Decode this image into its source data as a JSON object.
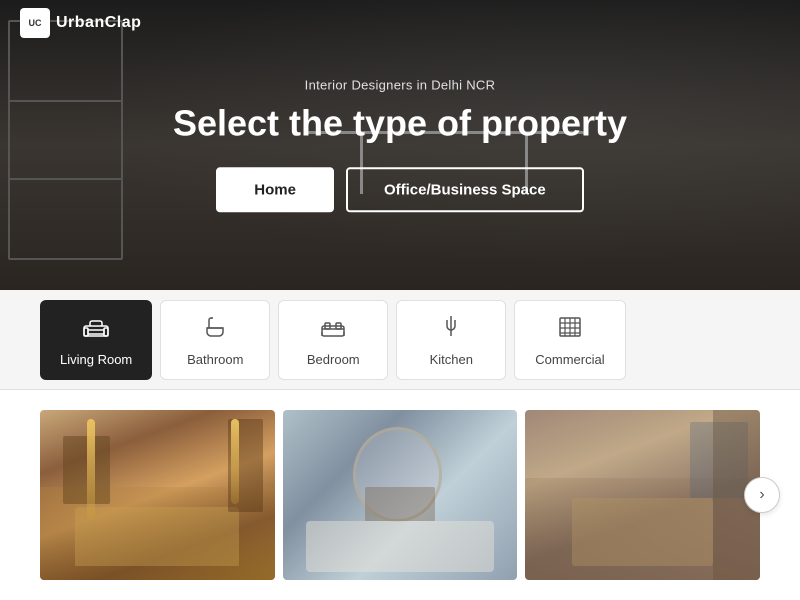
{
  "brand": {
    "logo_abbr": "UC",
    "name": "UrbanClap"
  },
  "hero": {
    "subtitle": "Interior Designers in Delhi NCR",
    "title": "Select the type of property",
    "buttons": [
      {
        "id": "home",
        "label": "Home",
        "style": "white"
      },
      {
        "id": "office",
        "label": "Office/Business Space",
        "style": "outline"
      }
    ]
  },
  "room_types": [
    {
      "id": "living-room",
      "label": "Living Room",
      "icon": "🛋",
      "active": true
    },
    {
      "id": "bathroom",
      "label": "Bathroom",
      "icon": "🛁",
      "active": false
    },
    {
      "id": "bedroom",
      "label": "Bedroom",
      "icon": "🛏",
      "active": false
    },
    {
      "id": "kitchen",
      "label": "Kitchen",
      "icon": "🍳",
      "active": false
    },
    {
      "id": "commercial",
      "label": "Commercial",
      "icon": "🏢",
      "active": false
    }
  ],
  "gallery": {
    "next_icon": "›",
    "images": [
      {
        "id": "img1",
        "alt": "Living room with warm wooden furniture"
      },
      {
        "id": "img2",
        "alt": "Living room with round mirror and fireplace"
      },
      {
        "id": "img3",
        "alt": "Living room with modern decor"
      }
    ]
  }
}
